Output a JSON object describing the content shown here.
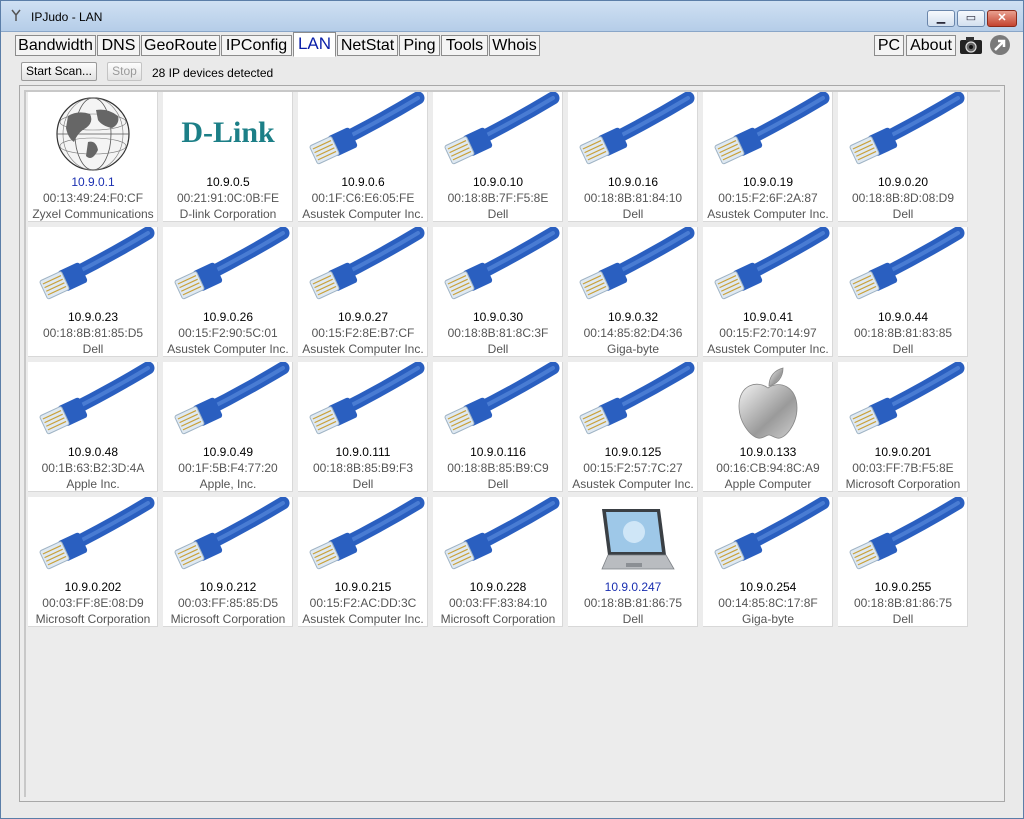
{
  "window": {
    "title": "IPJudo - LAN",
    "min_glyph": "▁",
    "max_glyph": "▭",
    "close_glyph": "✕"
  },
  "tabs": [
    "Bandwidth",
    "DNS",
    "GeoRoute",
    "IPConfig",
    "LAN",
    "NetStat",
    "Ping",
    "Tools",
    "Whois"
  ],
  "active_tab": "LAN",
  "right_tabs": [
    "PC",
    "About"
  ],
  "toolbar": {
    "start_label": "Start Scan...",
    "stop_label": "Stop",
    "status": "28 IP devices detected"
  },
  "colors": {
    "cable": "#2a5fc0",
    "accent": "#1a2fb0",
    "dlink": "#1c7f87"
  },
  "devices": [
    {
      "ip": "10.9.0.1",
      "mac": "00:13:49:24:F0:CF",
      "vendor": "Zyxel Communications",
      "icon": "globe-icon"
    },
    {
      "ip": "10.9.0.5",
      "mac": "00:21:91:0C:0B:FE",
      "vendor": "D-link Corporation",
      "icon": "dlink-logo-icon",
      "logo_text": "D-Link"
    },
    {
      "ip": "10.9.0.6",
      "mac": "00:1F:C6:E6:05:FE",
      "vendor": "Asustek Computer Inc.",
      "icon": "ethernet-cable-icon"
    },
    {
      "ip": "10.9.0.10",
      "mac": "00:18:8B:7F:F5:8E",
      "vendor": "Dell",
      "icon": "ethernet-cable-icon"
    },
    {
      "ip": "10.9.0.16",
      "mac": "00:18:8B:81:84:10",
      "vendor": "Dell",
      "icon": "ethernet-cable-icon"
    },
    {
      "ip": "10.9.0.19",
      "mac": "00:15:F2:6F:2A:87",
      "vendor": "Asustek Computer Inc.",
      "icon": "ethernet-cable-icon"
    },
    {
      "ip": "10.9.0.20",
      "mac": "00:18:8B:8D:08:D9",
      "vendor": "Dell",
      "icon": "ethernet-cable-icon"
    },
    {
      "ip": "10.9.0.23",
      "mac": "00:18:8B:81:85:D5",
      "vendor": "Dell",
      "icon": "ethernet-cable-icon"
    },
    {
      "ip": "10.9.0.26",
      "mac": "00:15:F2:90:5C:01",
      "vendor": "Asustek Computer Inc.",
      "icon": "ethernet-cable-icon"
    },
    {
      "ip": "10.9.0.27",
      "mac": "00:15:F2:8E:B7:CF",
      "vendor": "Asustek Computer Inc.",
      "icon": "ethernet-cable-icon"
    },
    {
      "ip": "10.9.0.30",
      "mac": "00:18:8B:81:8C:3F",
      "vendor": "Dell",
      "icon": "ethernet-cable-icon"
    },
    {
      "ip": "10.9.0.32",
      "mac": "00:14:85:82:D4:36",
      "vendor": "Giga-byte",
      "icon": "ethernet-cable-icon"
    },
    {
      "ip": "10.9.0.41",
      "mac": "00:15:F2:70:14:97",
      "vendor": "Asustek Computer Inc.",
      "icon": "ethernet-cable-icon"
    },
    {
      "ip": "10.9.0.44",
      "mac": "00:18:8B:81:83:85",
      "vendor": "Dell",
      "icon": "ethernet-cable-icon"
    },
    {
      "ip": "10.9.0.48",
      "mac": "00:1B:63:B2:3D:4A",
      "vendor": "Apple Inc.",
      "icon": "ethernet-cable-icon"
    },
    {
      "ip": "10.9.0.49",
      "mac": "00:1F:5B:F4:77:20",
      "vendor": "Apple, Inc.",
      "icon": "ethernet-cable-icon"
    },
    {
      "ip": "10.9.0.111",
      "mac": "00:18:8B:85:B9:F3",
      "vendor": "Dell",
      "icon": "ethernet-cable-icon"
    },
    {
      "ip": "10.9.0.116",
      "mac": "00:18:8B:85:B9:C9",
      "vendor": "Dell",
      "icon": "ethernet-cable-icon"
    },
    {
      "ip": "10.9.0.125",
      "mac": "00:15:F2:57:7C:27",
      "vendor": "Asustek Computer Inc.",
      "icon": "ethernet-cable-icon"
    },
    {
      "ip": "10.9.0.133",
      "mac": "00:16:CB:94:8C:A9",
      "vendor": "Apple Computer",
      "icon": "apple-logo-icon"
    },
    {
      "ip": "10.9.0.201",
      "mac": "00:03:FF:7B:F5:8E",
      "vendor": "Microsoft Corporation",
      "icon": "ethernet-cable-icon"
    },
    {
      "ip": "10.9.0.202",
      "mac": "00:03:FF:8E:08:D9",
      "vendor": "Microsoft Corporation",
      "icon": "ethernet-cable-icon"
    },
    {
      "ip": "10.9.0.212",
      "mac": "00:03:FF:85:85:D5",
      "vendor": "Microsoft Corporation",
      "icon": "ethernet-cable-icon"
    },
    {
      "ip": "10.9.0.215",
      "mac": "00:15:F2:AC:DD:3C",
      "vendor": "Asustek Computer Inc.",
      "icon": "ethernet-cable-icon"
    },
    {
      "ip": "10.9.0.228",
      "mac": "00:03:FF:83:84:10",
      "vendor": "Microsoft Corporation",
      "icon": "ethernet-cable-icon"
    },
    {
      "ip": "10.9.0.247",
      "mac": "00:18:8B:81:86:75",
      "vendor": "Dell",
      "icon": "laptop-icon"
    },
    {
      "ip": "10.9.0.254",
      "mac": "00:14:85:8C:17:8F",
      "vendor": "Giga-byte",
      "icon": "ethernet-cable-icon"
    },
    {
      "ip": "10.9.0.255",
      "mac": "00:18:8B:81:86:75",
      "vendor": "Dell",
      "icon": "ethernet-cable-icon"
    }
  ],
  "highlighted_ips": [
    "10.9.0.1",
    "10.9.0.247"
  ]
}
